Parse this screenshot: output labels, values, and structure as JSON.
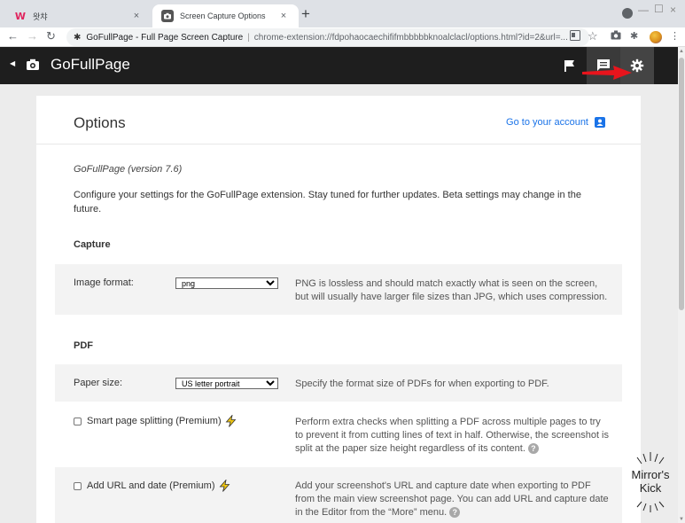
{
  "browser": {
    "tabs": [
      {
        "title": "왓챠",
        "favicon": "w-logo-icon",
        "active": false
      },
      {
        "title": "Screen Capture Options",
        "favicon": "camera-icon",
        "active": true
      }
    ],
    "new_tab": "+",
    "close_glyph": "×",
    "address": {
      "site_name": "GoFullPage - Full Page Screen Capture",
      "separator": "|",
      "url": "chrome-extension://fdpohaocaechififmbbbbbknoalclacl/options.html?id=2&url=..."
    }
  },
  "header": {
    "brand": "GoFullPage",
    "colors": {
      "background": "#1e1e1e",
      "arrow": "#e8141c"
    }
  },
  "card": {
    "title": "Options",
    "account_link": "Go to your account",
    "version": "GoFullPage (version 7.6)",
    "intro": "Configure your settings for the GoFullPage extension. Stay tuned for further updates. Beta settings may change in the future.",
    "sections": {
      "capture": {
        "heading": "Capture",
        "image_format": {
          "label": "Image format:",
          "value": "png",
          "description": "PNG is lossless and should match exactly what is seen on the screen, but will usually have larger file sizes than JPG, which uses compression."
        }
      },
      "pdf": {
        "heading": "PDF",
        "paper_size": {
          "label": "Paper size:",
          "value": "US letter portrait",
          "description": "Specify the format size of PDFs for when exporting to PDF."
        },
        "smart_split": {
          "label": "Smart page splitting (Premium)",
          "checked": false,
          "description": "Perform extra checks when splitting a PDF across multiple pages to try to prevent it from cutting lines of text in half. Otherwise, the screenshot is split at the paper size height regardless of its content."
        },
        "add_url": {
          "label": "Add URL and date (Premium)",
          "checked": false,
          "description": "Add your screenshot's URL and capture date when exporting to PDF from the main view screenshot page. You can add URL and capture date in the Editor from the “More” menu."
        }
      }
    },
    "help_glyph": "?"
  },
  "watermark": {
    "line1": "Mirror's",
    "line2": "Kick"
  }
}
